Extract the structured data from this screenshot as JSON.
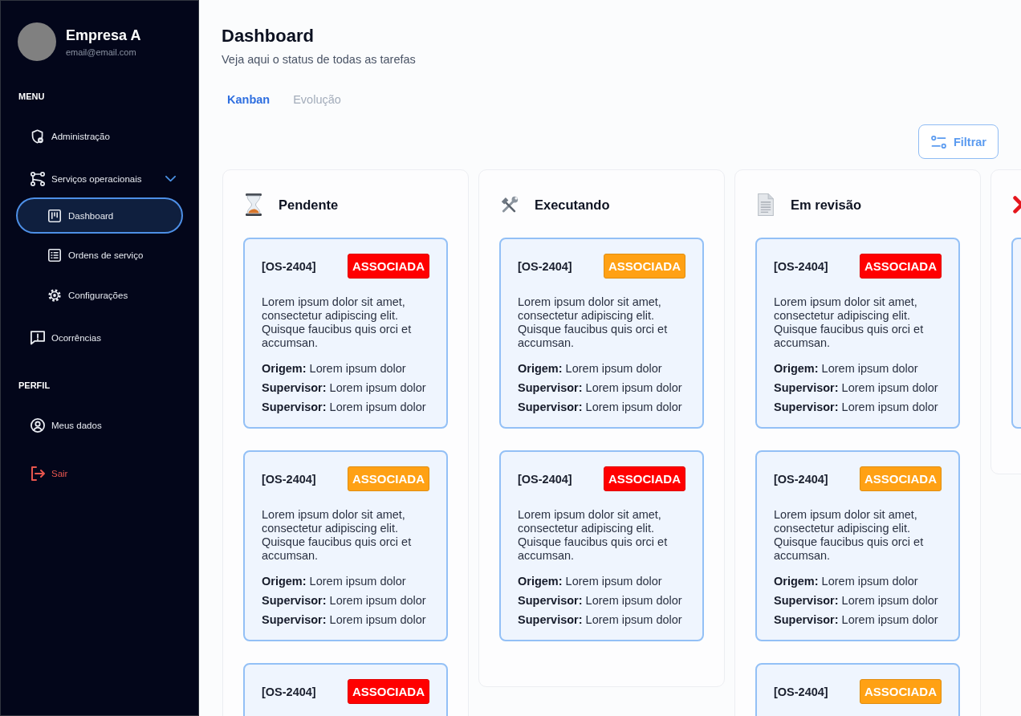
{
  "sidebar": {
    "profile": {
      "name": "Empresa A",
      "email": "email@email.com"
    },
    "sections": [
      {
        "label": "MENU",
        "items": [
          {
            "label": "Administração",
            "kind": "normal",
            "selected": false
          },
          {
            "label": "Serviços operacionais",
            "kind": "normal",
            "selected": false,
            "expanded": true,
            "children": [
              {
                "label": "Dashboard",
                "selected": true
              },
              {
                "label": "Ordens de serviço",
                "selected": false
              },
              {
                "label": "Configurações",
                "selected": false
              }
            ]
          },
          {
            "label": "Ocorrências",
            "kind": "normal",
            "selected": false
          }
        ]
      },
      {
        "label": "PERFIL",
        "items": [
          {
            "label": "Meus dados",
            "kind": "normal",
            "selected": false
          },
          {
            "label": "Sair",
            "kind": "danger",
            "selected": false
          }
        ]
      }
    ]
  },
  "header": {
    "title": "Dashboard",
    "subtitle": "Veja aqui o status de todas as tarefas"
  },
  "tabs": [
    {
      "label": "Kanban",
      "selected": true
    },
    {
      "label": "Evolução",
      "selected": false
    }
  ],
  "filter_button": {
    "label": "Filtrar"
  },
  "columns": [
    {
      "kind": "full",
      "title": "Pendente",
      "cards": [
        {
          "id": "[OS-2404]",
          "badge": {
            "label": "ASSOCIADA",
            "color": "#ff0000"
          },
          "description": "Lorem ipsum dolor sit amet, consectetur adipiscing elit. Quisque faucibus quis orci et accumsan.",
          "fields": [
            "**Origem:** Lorem ipsum dolor",
            "**Supervisor:** Lorem ipsum dolor",
            "**Supervisor:** Lorem ipsum dolor"
          ]
        },
        {
          "id": "[OS-2404]",
          "badge": {
            "label": "ASSOCIADA",
            "color": "#ffa114"
          },
          "description": "Lorem ipsum dolor sit amet, consectetur adipiscing elit. Quisque faucibus quis orci et accumsan.",
          "fields": [
            "**Origem:** Lorem ipsum dolor",
            "**Supervisor:** Lorem ipsum dolor",
            "**Supervisor:** Lorem ipsum dolor"
          ]
        },
        {
          "id": "[OS-2404]",
          "badge": {
            "label": "ASSOCIADA",
            "color": "#ff0000"
          }
        }
      ]
    },
    {
      "kind": "full",
      "title": "Executando",
      "cards": [
        {
          "id": "[OS-2404]",
          "badge": {
            "label": "ASSOCIADA",
            "color": "#ffa114"
          },
          "description": "Lorem ipsum dolor sit amet, consectetur adipiscing elit. Quisque faucibus quis orci et accumsan.",
          "fields": [
            "**Origem:** Lorem ipsum dolor",
            "**Supervisor:** Lorem ipsum dolor",
            "**Supervisor:** Lorem ipsum dolor"
          ]
        },
        {
          "id": "[OS-2404]",
          "badge": {
            "label": "ASSOCIADA",
            "color": "#ff0000"
          },
          "description": "Lorem ipsum dolor sit amet, consectetur adipiscing elit. Quisque faucibus quis orci et accumsan.",
          "fields": [
            "**Origem:** Lorem ipsum dolor",
            "**Supervisor:** Lorem ipsum dolor",
            "**Supervisor:** Lorem ipsum dolor"
          ]
        }
      ]
    },
    {
      "kind": "full",
      "title": "Em revisão",
      "cards": [
        {
          "id": "[OS-2404]",
          "badge": {
            "label": "ASSOCIADA",
            "color": "#ff0000"
          },
          "description": "Lorem ipsum dolor sit amet, consectetur adipiscing elit. Quisque faucibus quis orci et accumsan.",
          "fields": [
            "**Origem:** Lorem ipsum dolor",
            "**Supervisor:** Lorem ipsum dolor",
            "**Supervisor:** Lorem ipsum dolor"
          ]
        },
        {
          "id": "[OS-2404]",
          "badge": {
            "label": "ASSOCIADA",
            "color": "#ffa114"
          },
          "description": "Lorem ipsum dolor sit amet, consectetur adipiscing elit. Quisque faucibus quis orci et accumsan.",
          "fields": [
            "**Origem:** Lorem ipsum dolor",
            "**Supervisor:** Lorem ipsum dolor",
            "**Supervisor:** Lorem ipsum dolor"
          ]
        },
        {
          "id": "[OS-2404]",
          "badge": {
            "label": "ASSOCIADA",
            "color": "#ffa114"
          }
        }
      ]
    },
    {
      "kind": "clipped"
    }
  ]
}
